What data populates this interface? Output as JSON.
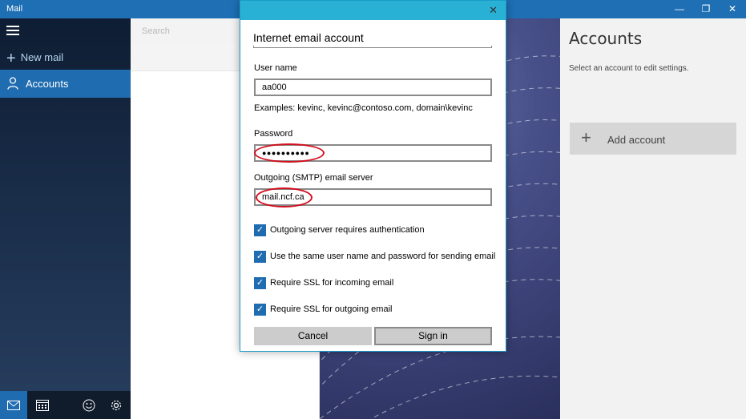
{
  "window": {
    "title": "Mail",
    "controls": {
      "minimize": "—",
      "restore": "❐",
      "close": "✕"
    }
  },
  "nav": {
    "menu_icon": "hamburger-icon",
    "new_mail": "New mail",
    "accounts": "Accounts",
    "bottom_icons": [
      "mail-icon",
      "calendar-icon",
      "smiley-icon",
      "gear-icon"
    ]
  },
  "list": {
    "search_placeholder": "Search"
  },
  "accounts_pane": {
    "title": "Accounts",
    "subtitle": "Select an account to edit settings.",
    "add_account": "Add account"
  },
  "dialog": {
    "title": "Internet email account",
    "close": "✕",
    "username_label": "User name",
    "username_value": "aa000",
    "username_hint": "Examples: kevinc, kevinc@contoso.com, domain\\kevinc",
    "password_label": "Password",
    "password_value": "●●●●●●●●●●",
    "smtp_label": "Outgoing (SMTP) email server",
    "smtp_value": "mail.ncf.ca",
    "checkboxes": [
      {
        "label": "Outgoing server requires authentication",
        "checked": true
      },
      {
        "label": "Use the same user name and password for sending email",
        "checked": true
      },
      {
        "label": "Require SSL for incoming email",
        "checked": true
      },
      {
        "label": "Require SSL for outgoing email",
        "checked": true
      }
    ],
    "cancel": "Cancel",
    "sign_in": "Sign in"
  },
  "colors": {
    "accent": "#1f6cb1",
    "dialog_header": "#29b0d5",
    "highlight_ellipse": "#d20f1e"
  }
}
